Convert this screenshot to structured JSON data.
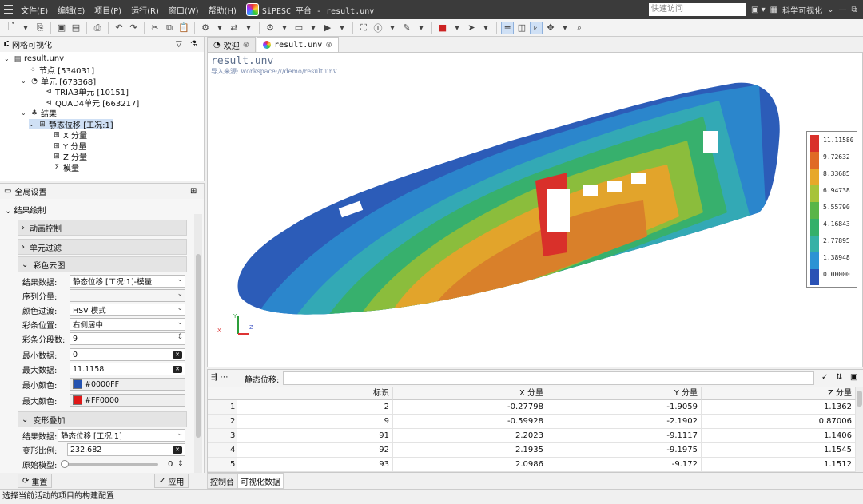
{
  "menubar": {
    "items": [
      "文件(E)",
      "编辑(E)",
      "项目(P)",
      "运行(R)",
      "窗口(W)",
      "帮助(H)"
    ],
    "title": "SiPESC 平台 - result.unv",
    "search_placeholder": "快速访问",
    "perspective": "科学可视化"
  },
  "mesh_panel": {
    "title": "网格可视化",
    "tree": {
      "file": "result.unv",
      "nodes": "节点 [534031]",
      "elements": "单元 [673368]",
      "tria3": "TRIA3单元 [10151]",
      "quad4": "QUAD4单元 [663217]",
      "results": "结果",
      "static": "静态位移 [工况:1]",
      "x": "X 分量",
      "y": "Y 分量",
      "z": "Z 分量",
      "mag": "模量"
    }
  },
  "settings": {
    "title": "全局设置",
    "result_draw": "结果绘制",
    "animation": "动画控制",
    "elem_filter": "单元过滤",
    "contour": "彩色云图",
    "result_data_label": "结果数据:",
    "result_data_value": "静态位移 [工况:1]-模量",
    "seq_label": "序列分量:",
    "seq_value": "",
    "color_trans_label": "颜色过渡:",
    "color_trans_value": "HSV 模式",
    "bar_pos_label": "彩条位置:",
    "bar_pos_value": "右侧居中",
    "bar_seg_label": "彩条分段数:",
    "bar_seg_value": "9",
    "min_label": "最小数据:",
    "min_value": "0",
    "max_label": "最大数据:",
    "max_value": "11.1158",
    "min_color_label": "最小颜色:",
    "min_color_value": "#0000FF",
    "max_color_label": "最大颜色:",
    "max_color_value": "#FF0000",
    "deform": "变形叠加",
    "deform_data_label": "结果数据:",
    "deform_data_value": "静态位移 [工况:1]",
    "scale_label": "变形比例:",
    "scale_value": "232.682",
    "orig_label": "原始模型:",
    "orig_value": "0",
    "reset": "重置",
    "apply": "应用"
  },
  "tabs": {
    "welcome": "欢迎",
    "result": "result.unv"
  },
  "viewport": {
    "title": "result.unv",
    "subtitle": "导入来源: workspace:///demo/result.unv",
    "axis_y": "Y",
    "axis_z": "Z",
    "axis_x": "X"
  },
  "colorbar": {
    "labels": [
      "11.11580",
      "9.72632",
      "8.33685",
      "6.94738",
      "5.55790",
      "4.16843",
      "2.77895",
      "1.38948",
      "0.00000"
    ],
    "colors": [
      "#d9302a",
      "#e06a25",
      "#e7a82a",
      "#a7c33a",
      "#59b548",
      "#34b06a",
      "#35b1a6",
      "#2c93d4",
      "#2a52b5"
    ]
  },
  "table": {
    "toolbar_label": "静态位移:",
    "headers": [
      "标识",
      "X 分量",
      "Y 分量",
      "Z 分量"
    ],
    "rows": [
      {
        "no": "1",
        "id": "2",
        "x": "-0.27798",
        "y": "-1.9059",
        "z": "1.1362"
      },
      {
        "no": "2",
        "id": "9",
        "x": "-0.59928",
        "y": "-2.1902",
        "z": "0.87006"
      },
      {
        "no": "3",
        "id": "91",
        "x": "2.2023",
        "y": "-9.1117",
        "z": "1.1406"
      },
      {
        "no": "4",
        "id": "92",
        "x": "2.1935",
        "y": "-9.1975",
        "z": "1.1545"
      },
      {
        "no": "5",
        "id": "93",
        "x": "2.0986",
        "y": "-9.172",
        "z": "1.1512"
      }
    ]
  },
  "bottom_tabs": [
    "控制台",
    "可视化数据"
  ],
  "status": "选择当前活动的项目的构建配置"
}
